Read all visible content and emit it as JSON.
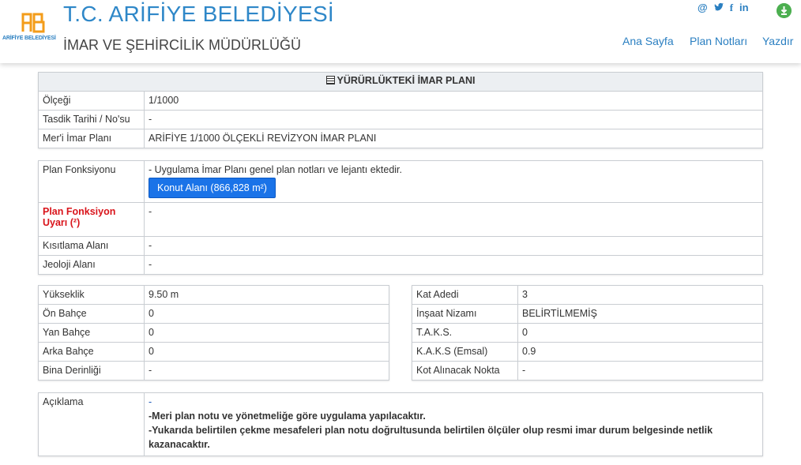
{
  "header": {
    "logo_text": "ARİFİYE BELEDİYESİ",
    "title": "T.C. ARİFİYE BELEDİYESİ",
    "subtitle": "İMAR VE ŞEHİRCİLİK MÜDÜRLÜĞÜ",
    "social_icons": [
      "at-icon",
      "twitter-icon",
      "facebook-icon",
      "linkedin-icon"
    ],
    "download_icon": "download-icon",
    "nav": [
      {
        "label": "Ana Sayfa"
      },
      {
        "label": "Plan Notları"
      },
      {
        "label": "Yazdır"
      }
    ]
  },
  "plan": {
    "title": "YÜRÜRLÜKTEKİ İMAR PLANI",
    "rows": [
      {
        "label": "Ölçeği",
        "value": "1/1000"
      },
      {
        "label": "Tasdik Tarihi / No'su",
        "value": "-"
      },
      {
        "label": "Mer'i İmar Planı",
        "value": "ARİFİYE 1/1000 ÖLÇEKLİ REVİZYON İMAR PLANI"
      }
    ]
  },
  "function": {
    "label": "Plan Fonksiyonu",
    "note": "- Uygulama İmar Planı genel plan notları ve lejantı ektedir.",
    "button": "Konut Alanı (866,828 m²)",
    "warning_label": "Plan Fonksiyon Uyarı (²)",
    "warning_value": "-",
    "rows": [
      {
        "label": "Kısıtlama Alanı",
        "value": "-"
      },
      {
        "label": "Jeoloji Alanı",
        "value": "-"
      }
    ]
  },
  "left": [
    {
      "label": "Yükseklik",
      "value": "9.50 m"
    },
    {
      "label": "Ön Bahçe",
      "value": "0"
    },
    {
      "label": "Yan Bahçe",
      "value": "0"
    },
    {
      "label": "Arka Bahçe",
      "value": "0"
    },
    {
      "label": "Bina Derinliği",
      "value": "-"
    }
  ],
  "right": [
    {
      "label": "Kat Adedi",
      "value": "3"
    },
    {
      "label": "İnşaat Nizamı",
      "value": "BELİRTİLMEMİŞ"
    },
    {
      "label": "T.A.K.S.",
      "value": "0"
    },
    {
      "label": "K.A.K.S (Emsal)",
      "value": "0.9"
    },
    {
      "label": "Kot Alınacak Nokta",
      "value": "-"
    }
  ],
  "description": {
    "label": "Açıklama",
    "dash": "-",
    "line1": "-Meri plan notu ve yönetmeliğe göre uygulama yapılacaktır.",
    "line2": "-Yukarıda belirtilen çekme mesafeleri plan notu doğrultusunda belirtilen ölçüler olup resmi imar durum belgesinde netlik kazanacaktır."
  }
}
